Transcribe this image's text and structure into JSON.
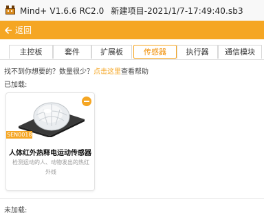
{
  "window": {
    "app": "Mind+ V1.6.6 RC2.0",
    "project": "新建项目-2021/1/7-17:49:40.sb3"
  },
  "header": {
    "back_label": "返回"
  },
  "tabs": [
    {
      "label": "主控板",
      "active": false
    },
    {
      "label": "套件",
      "active": false
    },
    {
      "label": "扩展板",
      "active": false
    },
    {
      "label": "传感器",
      "active": true
    },
    {
      "label": "执行器",
      "active": false
    },
    {
      "label": "通信模块",
      "active": false
    }
  ],
  "help": {
    "prefix": "找不到你想要的？数量很少？",
    "link": "点击这里",
    "suffix": "查看帮助"
  },
  "sections": {
    "loaded": "已加载:",
    "not_loaded": "未加载:"
  },
  "card": {
    "sku": "SEN0018",
    "title": "人体红外热释电运动传感器",
    "description": "检测运动的人、动物发出的热红外线"
  },
  "colors": {
    "accent": "#f5a623"
  }
}
